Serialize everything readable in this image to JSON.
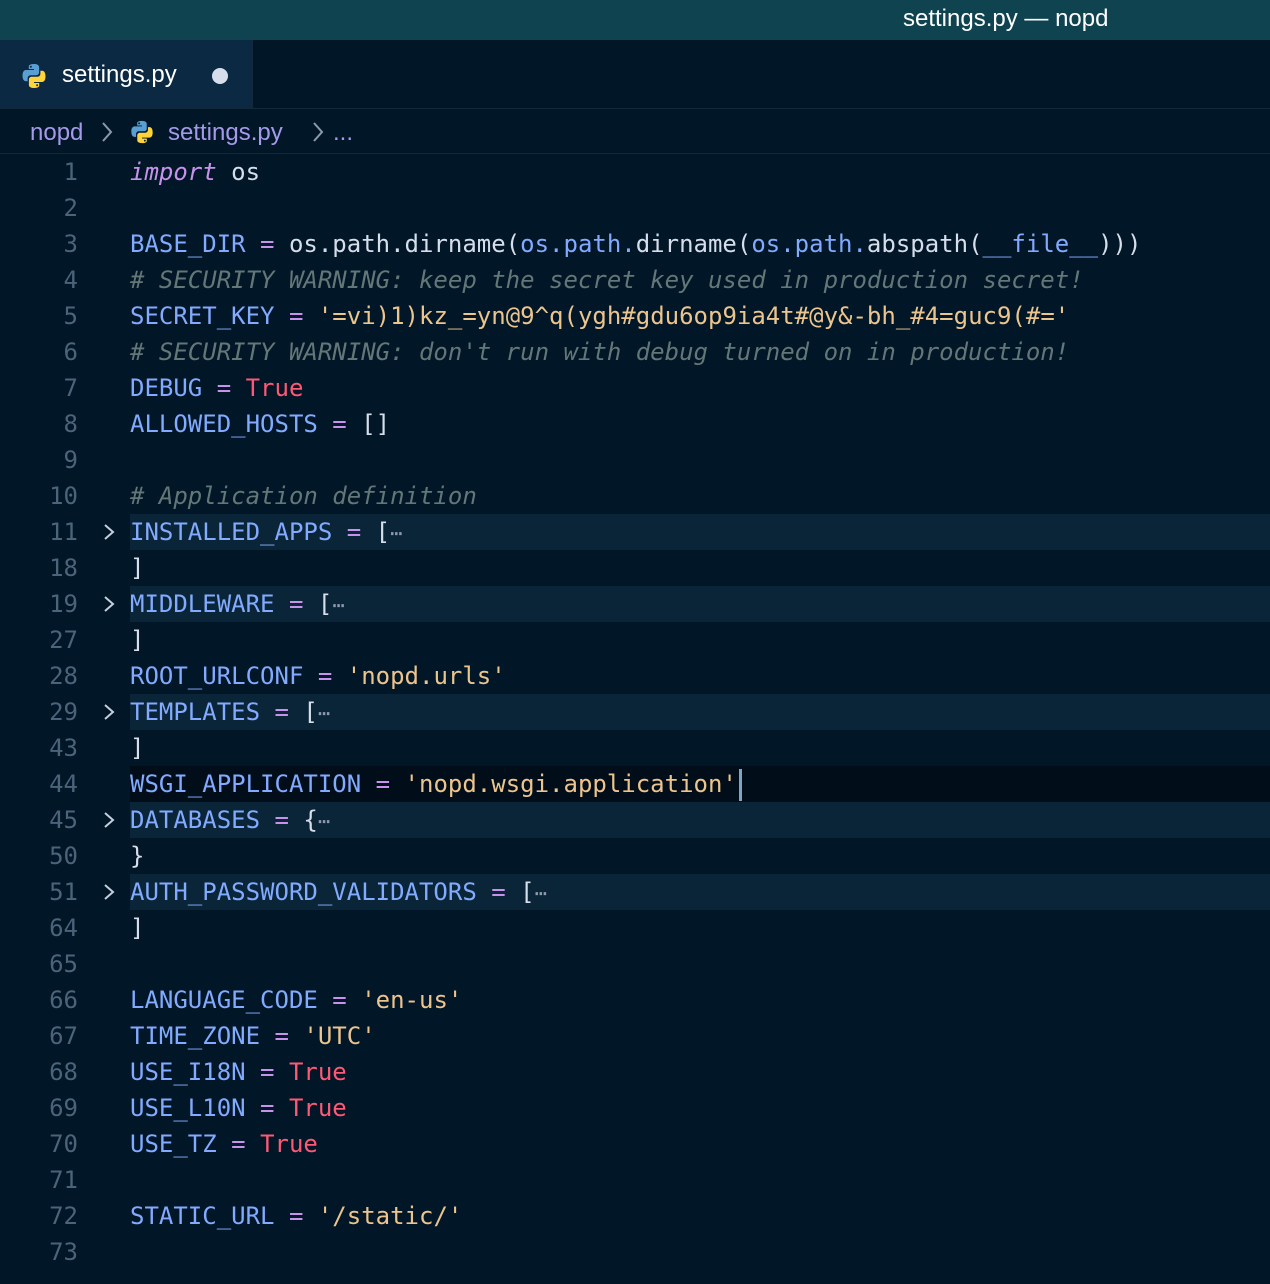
{
  "window": {
    "title": "settings.py — nopd"
  },
  "tab": {
    "label": "settings.py",
    "icon": "python-icon",
    "modified_indicator": "●"
  },
  "breadcrumb": {
    "folder": "nopd",
    "file": "settings.py",
    "more": "...",
    "separator": ">"
  },
  "colors": {
    "background": "#011627",
    "titlebar": "#0e434f",
    "keyword": "#c792ea",
    "variable": "#82aaff",
    "string": "#ecc48d",
    "boolean": "#ff5874",
    "comment": "#637777"
  },
  "code_lines": [
    {
      "n": "1",
      "tokens": [
        [
          "kw",
          "import"
        ],
        [
          "plain",
          " os"
        ]
      ]
    },
    {
      "n": "2",
      "tokens": []
    },
    {
      "n": "3",
      "tokens": [
        [
          "var",
          "BASE_DIR"
        ],
        [
          "op",
          " = "
        ],
        [
          "plain",
          "os.path.dirname("
        ],
        [
          "mod",
          "os.path."
        ],
        [
          "plain",
          "dirname("
        ],
        [
          "mod",
          "os.path."
        ],
        [
          "plain",
          "abspath("
        ],
        [
          "var",
          "__file__"
        ],
        [
          "plain",
          ")))"
        ]
      ]
    },
    {
      "n": "4",
      "tokens": [
        [
          "cmt",
          "# SECURITY WARNING: keep the secret key used in production secret!"
        ]
      ]
    },
    {
      "n": "5",
      "tokens": [
        [
          "var",
          "SECRET_KEY"
        ],
        [
          "op",
          " = "
        ],
        [
          "str",
          "'=vi)1)kz_=yn@9^q(ygh#gdu6op9ia4t#@y&-bh_#4=guc9(#='"
        ]
      ]
    },
    {
      "n": "6",
      "tokens": [
        [
          "cmt",
          "# SECURITY WARNING: don't run with debug turned on in production!"
        ]
      ]
    },
    {
      "n": "7",
      "tokens": [
        [
          "var",
          "DEBUG"
        ],
        [
          "op",
          " = "
        ],
        [
          "bool",
          "True"
        ]
      ]
    },
    {
      "n": "8",
      "tokens": [
        [
          "var",
          "ALLOWED_HOSTS"
        ],
        [
          "op",
          " = "
        ],
        [
          "plain",
          "[]"
        ]
      ]
    },
    {
      "n": "9",
      "tokens": []
    },
    {
      "n": "10",
      "tokens": [
        [
          "cmt",
          "# Application definition"
        ]
      ]
    },
    {
      "n": "11",
      "folded": true,
      "tokens": [
        [
          "var",
          "INSTALLED_APPS"
        ],
        [
          "op",
          " = "
        ],
        [
          "plain",
          "["
        ],
        [
          "ell",
          "⋯"
        ]
      ]
    },
    {
      "n": "18",
      "tokens": [
        [
          "plain",
          "]"
        ]
      ]
    },
    {
      "n": "19",
      "folded": true,
      "tokens": [
        [
          "var",
          "MIDDLEWARE"
        ],
        [
          "op",
          " = "
        ],
        [
          "plain",
          "["
        ],
        [
          "ell",
          "⋯"
        ]
      ]
    },
    {
      "n": "27",
      "tokens": [
        [
          "plain",
          "]"
        ]
      ]
    },
    {
      "n": "28",
      "tokens": [
        [
          "var",
          "ROOT_URLCONF"
        ],
        [
          "op",
          " = "
        ],
        [
          "str",
          "'nopd.urls'"
        ]
      ]
    },
    {
      "n": "29",
      "folded": true,
      "tokens": [
        [
          "var",
          "TEMPLATES"
        ],
        [
          "op",
          " = "
        ],
        [
          "plain",
          "["
        ],
        [
          "ell",
          "⋯"
        ]
      ]
    },
    {
      "n": "43",
      "tokens": [
        [
          "plain",
          "]"
        ]
      ]
    },
    {
      "n": "44",
      "current": true,
      "tokens": [
        [
          "var",
          "WSGI_APPLICATION"
        ],
        [
          "op",
          " = "
        ],
        [
          "str",
          "'nopd.wsgi.application'"
        ]
      ]
    },
    {
      "n": "45",
      "folded": true,
      "tokens": [
        [
          "var",
          "DATABASES"
        ],
        [
          "op",
          " = "
        ],
        [
          "plain",
          "{"
        ],
        [
          "ell",
          "⋯"
        ]
      ]
    },
    {
      "n": "50",
      "tokens": [
        [
          "plain",
          "}"
        ]
      ]
    },
    {
      "n": "51",
      "folded": true,
      "tokens": [
        [
          "var",
          "AUTH_PASSWORD_VALIDATORS"
        ],
        [
          "op",
          " = "
        ],
        [
          "plain",
          "["
        ],
        [
          "ell",
          "⋯"
        ]
      ]
    },
    {
      "n": "64",
      "tokens": [
        [
          "plain",
          "]"
        ]
      ]
    },
    {
      "n": "65",
      "tokens": []
    },
    {
      "n": "66",
      "tokens": [
        [
          "var",
          "LANGUAGE_CODE"
        ],
        [
          "op",
          " = "
        ],
        [
          "str",
          "'en-us'"
        ]
      ]
    },
    {
      "n": "67",
      "tokens": [
        [
          "var",
          "TIME_ZONE"
        ],
        [
          "op",
          " = "
        ],
        [
          "str",
          "'UTC'"
        ]
      ]
    },
    {
      "n": "68",
      "tokens": [
        [
          "var",
          "USE_I18N"
        ],
        [
          "op",
          " = "
        ],
        [
          "bool",
          "True"
        ]
      ]
    },
    {
      "n": "69",
      "tokens": [
        [
          "var",
          "USE_L10N"
        ],
        [
          "op",
          " = "
        ],
        [
          "bool",
          "True"
        ]
      ]
    },
    {
      "n": "70",
      "tokens": [
        [
          "var",
          "USE_TZ"
        ],
        [
          "op",
          " = "
        ],
        [
          "bool",
          "True"
        ]
      ]
    },
    {
      "n": "71",
      "tokens": []
    },
    {
      "n": "72",
      "tokens": [
        [
          "var",
          "STATIC_URL"
        ],
        [
          "op",
          " = "
        ],
        [
          "str",
          "'/static/'"
        ]
      ]
    },
    {
      "n": "73",
      "tokens": []
    }
  ]
}
